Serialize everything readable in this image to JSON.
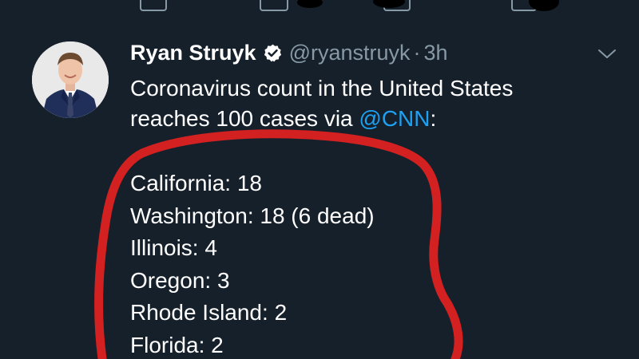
{
  "tweet": {
    "display_name": "Ryan Struyk",
    "handle": "@ryanstruyk",
    "separator": "·",
    "timestamp": "3h",
    "text_line1": "Coronavirus count in the United States",
    "text_line2_prefix": "reaches 100 cases via ",
    "mention": "@CNN",
    "text_line2_suffix": ":",
    "cases": [
      {
        "text": "California: 18"
      },
      {
        "text": "Washington: 18 (6 dead)"
      },
      {
        "text": "Illinois: 4"
      },
      {
        "text": "Oregon: 3"
      },
      {
        "text": "Rhode Island: 2"
      },
      {
        "text": "Florida: 2"
      }
    ]
  },
  "icons": {
    "verified": "verified-badge-icon",
    "more": "chevron-down-icon"
  },
  "colors": {
    "background": "#15202b",
    "text_primary": "#ffffff",
    "text_secondary": "#8899a6",
    "link": "#1da1f2",
    "annotation": "#d32020"
  }
}
